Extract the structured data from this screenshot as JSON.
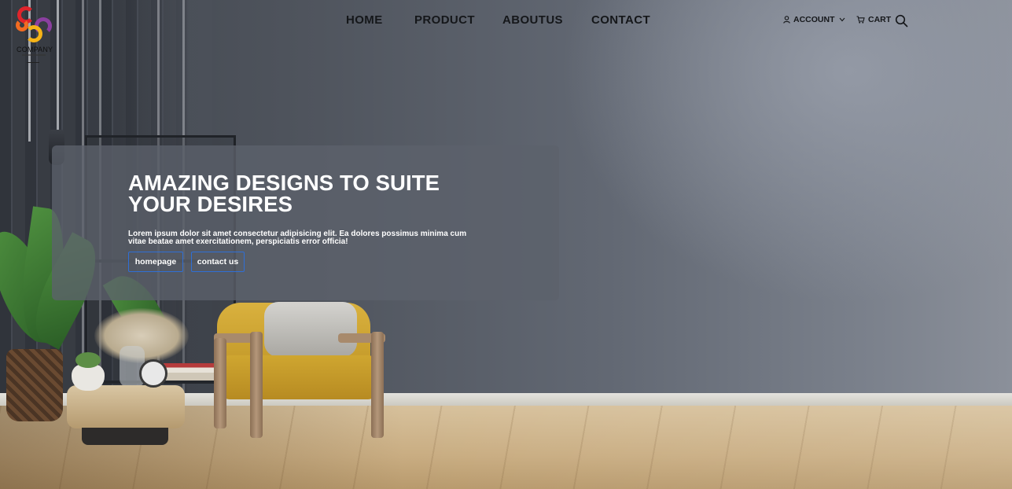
{
  "brand": {
    "name": "COMPANY",
    "colors": {
      "red": "#e0242b",
      "yellow": "#f6b417",
      "purple": "#8b3fa0",
      "orange": "#f26b21"
    }
  },
  "nav": {
    "items": [
      {
        "label": "HOME"
      },
      {
        "label": "PRODUCT"
      },
      {
        "label": "ABOUTUS"
      },
      {
        "label": "CONTACT"
      }
    ]
  },
  "utility": {
    "account_label": "ACCOUNT",
    "account_icon": "user-icon",
    "account_chevron": "chevron-down-icon",
    "cart_label": "CART",
    "cart_icon": "cart-icon",
    "search_icon": "search-icon"
  },
  "hero": {
    "title_line1": "AMAZING DESIGNS TO SUITE",
    "title_line2": "YOUR DESIRES",
    "body": "Lorem ipsum dolor sit amet consectetur adipisicing elit. Ea dolores possimus minima cum vitae beatae amet exercitationem, perspiciatis error officia!",
    "buttons": [
      {
        "label": "homepage"
      },
      {
        "label": "contact us"
      }
    ],
    "button_border_color": "#2f6fd6"
  }
}
